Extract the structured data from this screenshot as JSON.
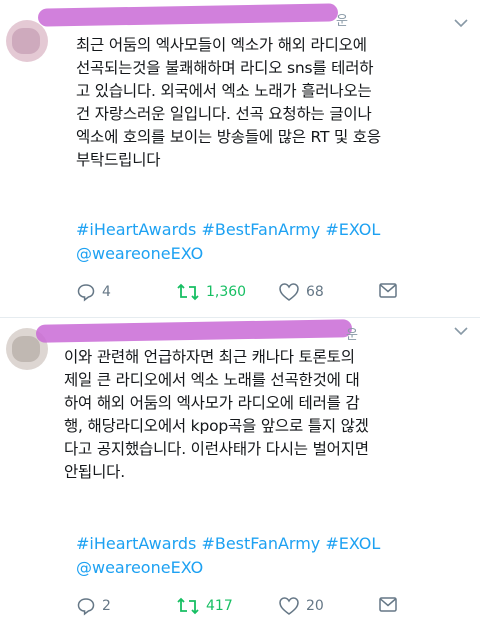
{
  "tweets": [
    {
      "handle_suffix": "운",
      "body_lines": [
        "최근 어둠의 엑사모들이 엑소가 해외 라디오에",
        "선곡되는것을 불쾌해하며 라디오 sns를 테러하",
        "고 있습니다. 외국에서 엑소 노래가 흘러나오는",
        "건 자랑스러운 일입니다. 선곡 요청하는 글이나",
        "엑소에 호의를 보이는 방송들에 많은 RT 및 호응",
        "부탁드립니다"
      ],
      "hashtags": "#iHeartAwards #BestFanArmy #EXOL",
      "mention": "@weareoneEXO",
      "replies": "4",
      "retweets": "1,360",
      "likes": "68"
    },
    {
      "handle_suffix": "운",
      "body_lines": [
        "이와 관련해 언급하자면 최근 캐나다 토론토의",
        "제일 큰 라디오에서 엑소 노래를 선곡한것에 대",
        "하여 해외 어둠의 엑사모가 라디오에 테러를 감",
        "행, 해당라디오에서 kpop곡을 앞으로 틀지 않겠",
        "다고 공지했습니다. 이런사태가 다시는 벌어지면",
        "안됩니다."
      ],
      "hashtags": "#iHeartAwards #BestFanArmy #EXOL",
      "mention": "@weareoneEXO",
      "replies": "2",
      "retweets": "417",
      "likes": "20"
    }
  ],
  "icons": {
    "reply": "reply-icon",
    "retweet": "retweet-icon",
    "like": "heart-icon",
    "dm": "direct-message-icon",
    "more": "chevron-down-icon"
  },
  "colors": {
    "link": "#1da1f2",
    "retweeted": "#17bf63",
    "redaction": "#c96ad6",
    "muted": "#657786"
  }
}
